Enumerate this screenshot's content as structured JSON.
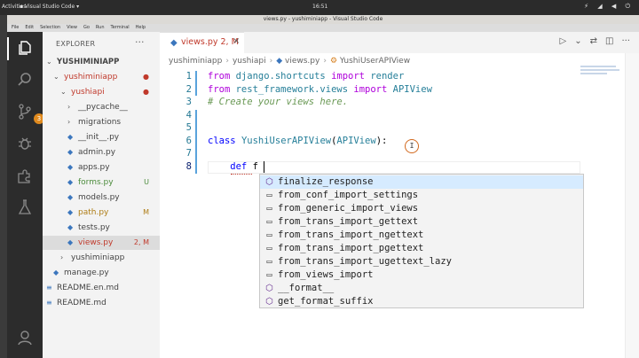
{
  "system_bar": {
    "activities": "Activities",
    "app_name": "Visual Studio Code",
    "clock": "16:51"
  },
  "window": {
    "title": "views.py - yushiminiapp - Visual Studio Code"
  },
  "menu": [
    "File",
    "Edit",
    "Selection",
    "View",
    "Go",
    "Run",
    "Terminal",
    "Help"
  ],
  "activity_bar": {
    "source_control_badge": "3"
  },
  "explorer": {
    "title": "EXPLORER",
    "more": "···",
    "tree": [
      {
        "label": "YUSHIMINIAPP",
        "chevron": "⌄",
        "status": "",
        "status_class": "",
        "label_class": "",
        "is_root": true
      },
      {
        "label": "yushiminiapp",
        "chevron": "⌄",
        "status": "●",
        "status_class": "err",
        "label_class": "err"
      },
      {
        "label": "yushiapi",
        "chevron": "⌄",
        "status": "●",
        "status_class": "err",
        "label_class": "err"
      },
      {
        "label": "__pycache__",
        "chevron": "›",
        "status": "",
        "status_class": "",
        "label_class": ""
      },
      {
        "label": "migrations",
        "chevron": "›",
        "status": "",
        "status_class": "",
        "label_class": ""
      },
      {
        "label": "__init__.py",
        "icon": "py",
        "status": "",
        "status_class": "",
        "label_class": ""
      },
      {
        "label": "admin.py",
        "icon": "py",
        "status": "",
        "status_class": "",
        "label_class": ""
      },
      {
        "label": "apps.py",
        "icon": "py",
        "status": "",
        "status_class": "",
        "label_class": ""
      },
      {
        "label": "forms.py",
        "icon": "py",
        "status": "U",
        "status_class": "untr",
        "label_class": "untr"
      },
      {
        "label": "models.py",
        "icon": "py",
        "status": "",
        "status_class": "",
        "label_class": ""
      },
      {
        "label": "path.py",
        "icon": "py",
        "status": "M",
        "status_class": "mod",
        "label_class": "mod"
      },
      {
        "label": "tests.py",
        "icon": "py",
        "status": "",
        "status_class": "",
        "label_class": ""
      },
      {
        "label": "views.py",
        "icon": "py",
        "status": "2, M",
        "status_class": "err",
        "label_class": "err",
        "selected": true
      },
      {
        "label": "yushiminiapp",
        "chevron": "›",
        "status": "",
        "status_class": "",
        "label_class": ""
      },
      {
        "label": "manage.py",
        "icon": "py",
        "status": "",
        "status_class": "",
        "label_class": ""
      },
      {
        "label": "README.en.md",
        "icon": "md",
        "status": "",
        "status_class": "",
        "label_class": ""
      },
      {
        "label": "README.md",
        "icon": "md",
        "status": "",
        "status_class": "",
        "label_class": ""
      }
    ]
  },
  "tab": {
    "label": "views.py 2, M"
  },
  "breadcrumb": [
    "yushiminiapp",
    "yushiapi",
    "views.py",
    "YushiUserAPIView"
  ],
  "editor": {
    "lines": [
      {
        "num": "1",
        "parts": [
          {
            "t": "from ",
            "c": "kw2"
          },
          {
            "t": "django.shortcuts ",
            "c": "mod2"
          },
          {
            "t": "import ",
            "c": "kw2"
          },
          {
            "t": "render",
            "c": "fn"
          }
        ]
      },
      {
        "num": "2",
        "parts": [
          {
            "t": "from ",
            "c": "kw2"
          },
          {
            "t": "rest_framework.views ",
            "c": "mod2"
          },
          {
            "t": "import ",
            "c": "kw2"
          },
          {
            "t": "APIView",
            "c": "fn"
          }
        ]
      },
      {
        "num": "3",
        "parts": [
          {
            "t": "# Create your views here.",
            "c": "cmt"
          }
        ]
      },
      {
        "num": "4",
        "parts": []
      },
      {
        "num": "5",
        "parts": []
      },
      {
        "num": "6",
        "parts": [
          {
            "t": "class ",
            "c": "kw"
          },
          {
            "t": "YushiUserAPIView",
            "c": "fn"
          },
          {
            "t": "(",
            "c": ""
          },
          {
            "t": "APIView",
            "c": "fn"
          },
          {
            "t": "):",
            "c": ""
          }
        ]
      },
      {
        "num": "7",
        "parts": []
      },
      {
        "num": "8",
        "parts": [
          {
            "t": "    def ",
            "c": "kw"
          },
          {
            "t": "f",
            "c": ""
          }
        ]
      }
    ],
    "cursor_hint": "I"
  },
  "suggest": {
    "items": [
      {
        "label": "finalize_response",
        "kind": "method"
      },
      {
        "label": "from_conf_import_settings",
        "kind": "snippet"
      },
      {
        "label": "from_generic_import_views",
        "kind": "snippet"
      },
      {
        "label": "from_trans_import_gettext",
        "kind": "snippet"
      },
      {
        "label": "from_trans_import_ngettext",
        "kind": "snippet"
      },
      {
        "label": "from_trans_import_pgettext",
        "kind": "snippet"
      },
      {
        "label": "from_trans_import_ugettext_lazy",
        "kind": "snippet"
      },
      {
        "label": "from_views_import",
        "kind": "snippet"
      },
      {
        "label": "__format__",
        "kind": "method"
      },
      {
        "label": "get_format_suffix",
        "kind": "method"
      }
    ]
  }
}
